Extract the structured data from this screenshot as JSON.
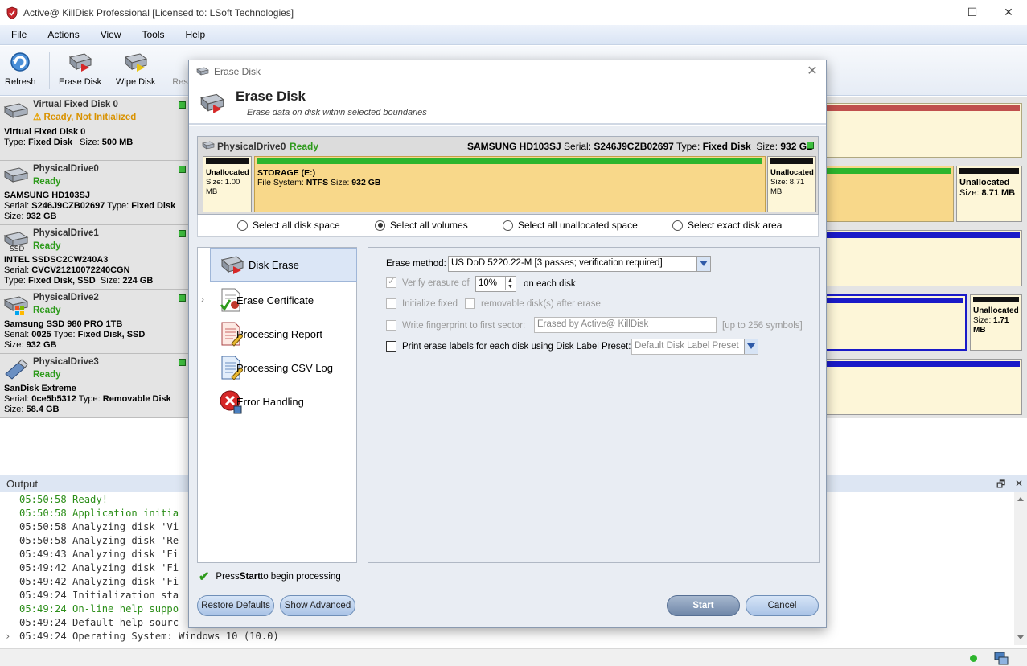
{
  "window": {
    "title": "Active@ KillDisk Professional [Licensed to: LSoft Technologies]",
    "minimize": "—",
    "maximize": "☐",
    "close": "✕"
  },
  "menu": [
    "File",
    "Actions",
    "View",
    "Tools",
    "Help"
  ],
  "toolbar": {
    "refresh": "Refresh",
    "erase_disk": "Erase Disk",
    "wipe_disk": "Wipe Disk",
    "resume_partial": "Res"
  },
  "disks": [
    {
      "name": "Virtual Fixed Disk 0",
      "status": "Ready, Not Initialized",
      "line1": "Virtual Fixed Disk 0",
      "line2_label": "Type:",
      "line2_value": "Fixed Disk",
      "line2b_label": "Size:",
      "line2b_value": "500 MB",
      "line3": ""
    },
    {
      "name": "PhysicalDrive0",
      "status": "Ready",
      "line1": "SAMSUNG HD103SJ",
      "serial_label": "Serial:",
      "serial": "S246J9CZB02697",
      "type_label": "Type:",
      "type": "Fixed Disk",
      "size_label": "Size:",
      "size": "932 GB"
    },
    {
      "name": "PhysicalDrive1",
      "status": "Ready",
      "line1": "INTEL SSDSC2CW240A3",
      "serial_label": "Serial:",
      "serial": "CVCV21210072240CGN",
      "type_label": "Type:",
      "type": "Fixed Disk, SSD",
      "size_label": "Size:",
      "size": "224 GB",
      "badge": "SSD"
    },
    {
      "name": "PhysicalDrive2",
      "status": "Ready",
      "line1": "Samsung SSD 980 PRO 1TB",
      "serial_label": "Serial:",
      "serial": "0025",
      "type_label": "Type:",
      "type": "Fixed Disk, SSD",
      "size_label": "Size:",
      "size": "932 GB"
    },
    {
      "name": "PhysicalDrive3",
      "status": "Ready",
      "line1": "SanDisk Extreme",
      "serial_label": "Serial:",
      "serial": "0ce5b5312",
      "type_label": "Type:",
      "type": "Removable Disk",
      "size_label": "Size:",
      "size": "58.4 GB"
    }
  ],
  "background_map": {
    "unallocated_a": {
      "label": "Unallocated",
      "size_label": "Size:",
      "size": "8.71 MB"
    },
    "unallocated_b": {
      "label": "Unallocated",
      "size_label": "Size:",
      "size": "1.71 MB"
    }
  },
  "output": {
    "title": "Output",
    "lines": [
      {
        "text": "05:50:58 Ready!",
        "color": "green"
      },
      {
        "text": "05:50:58 Application initia",
        "color": "green"
      },
      {
        "text": "05:50:58 Analyzing disk 'Vi",
        "color": "gray"
      },
      {
        "text": "05:50:58 Analyzing disk 'Re",
        "color": "gray"
      },
      {
        "text": "05:49:43 Analyzing disk 'Fi",
        "color": "gray"
      },
      {
        "text": "05:49:42 Analyzing disk 'Fi",
        "color": "gray"
      },
      {
        "text": "05:49:42 Analyzing disk 'Fi",
        "color": "gray"
      },
      {
        "text": "05:49:24 Initialization sta",
        "color": "gray"
      },
      {
        "text": "05:49:24 On-line help suppo",
        "color": "green"
      },
      {
        "text": "05:49:24 Default help sourc",
        "color": "gray"
      },
      {
        "text": "05:49:24 Operating System: Windows 10 (10.0)",
        "color": "gray"
      }
    ],
    "restore_icon": "🗗",
    "close_icon": "✕"
  },
  "dialog": {
    "window_title": "Erase Disk",
    "header_title": "Erase Disk",
    "header_subtitle": "Erase data on disk within selected boundaries",
    "disk": {
      "name": "PhysicalDrive0",
      "status": "Ready",
      "model": "SAMSUNG HD103SJ",
      "serial_label": "Serial:",
      "serial": "S246J9CZB02697",
      "type_label": "Type:",
      "type": "Fixed Disk",
      "size_label": "Size:",
      "size": "932 GB"
    },
    "volumes": [
      {
        "label": "Unallocated",
        "size_label": "Size:",
        "size": "1.00 MB"
      },
      {
        "label": "STORAGE (E:)",
        "fs_label": "File System:",
        "fs": "NTFS",
        "size_label": "Size:",
        "size": "932 GB"
      },
      {
        "label": "Unallocated",
        "size_label": "Size:",
        "size": "8.71 MB"
      }
    ],
    "radios": [
      {
        "label": "Select all disk space",
        "selected": false
      },
      {
        "label": "Select all volumes",
        "selected": true
      },
      {
        "label": "Select all unallocated space",
        "selected": false
      },
      {
        "label": "Select exact disk area",
        "selected": false
      }
    ],
    "nav": [
      {
        "label": "Disk Erase",
        "active": true
      },
      {
        "label": "Erase Certificate",
        "active": false
      },
      {
        "label": "Processing Report",
        "active": false
      },
      {
        "label": "Processing CSV Log",
        "active": false
      },
      {
        "label": "Error Handling",
        "active": false
      }
    ],
    "options": {
      "erase_method_label": "Erase method:",
      "erase_method_value": "US DoD 5220.22-M [3 passes; verification required]",
      "verify_label": "Verify erasure of",
      "verify_value": "10%",
      "verify_suffix": "on each disk",
      "init_fixed_label": "Initialize fixed",
      "init_removable_label": "removable disk(s) after erase",
      "fingerprint_label": "Write fingerprint to first sector:",
      "fingerprint_value": "Erased by Active@ KillDisk",
      "fingerprint_hint": "[up to 256 symbols]",
      "print_labels_label": "Print erase labels for each disk using Disk Label Preset:",
      "print_labels_value": "Default Disk Label Preset"
    },
    "hint_prefix": "Press ",
    "hint_bold": "Start",
    "hint_suffix": " to begin processing",
    "buttons": {
      "restore_defaults": "Restore Defaults",
      "show_advanced": "Show Advanced",
      "start": "Start",
      "cancel": "Cancel"
    }
  }
}
